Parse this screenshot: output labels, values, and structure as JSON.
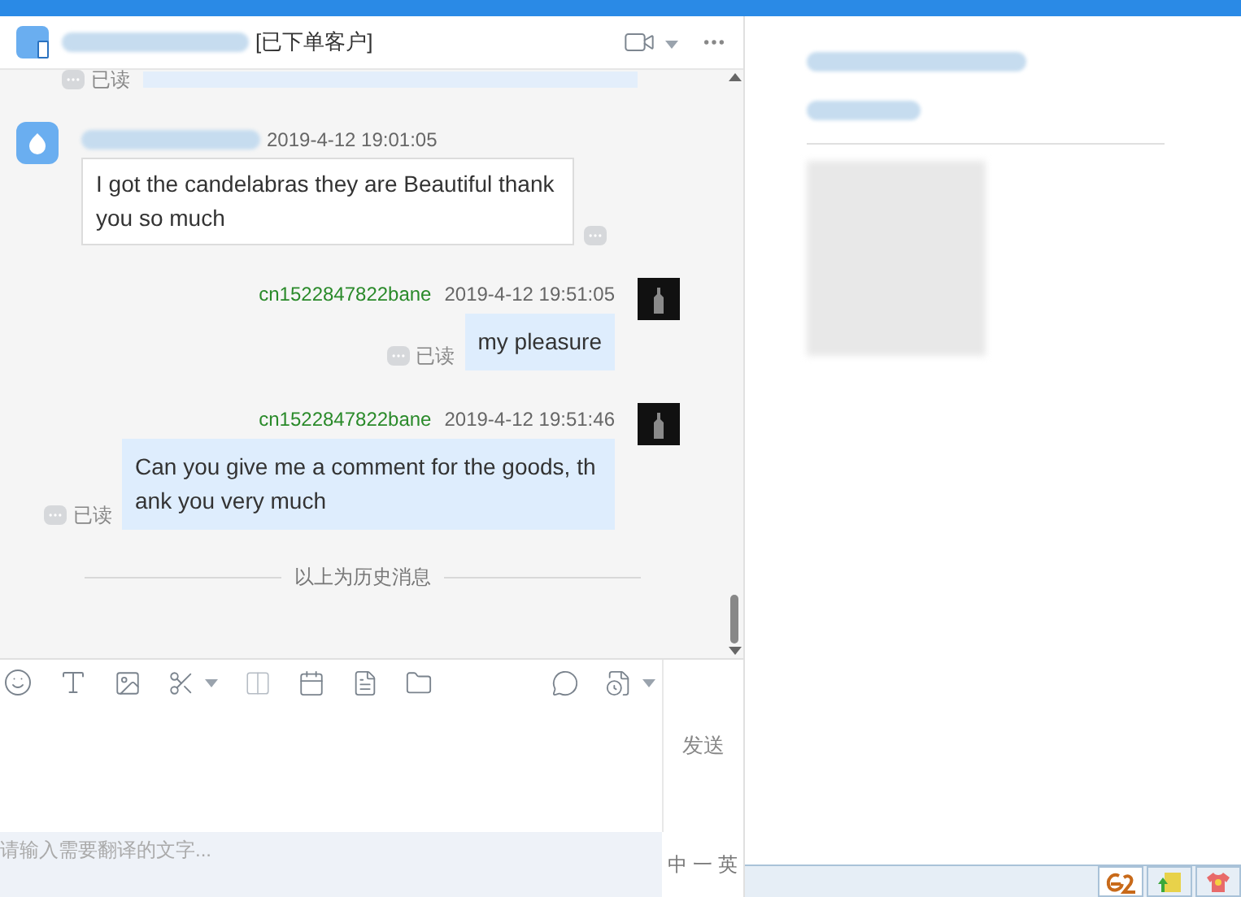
{
  "header": {
    "contact_tag": "[已下单客户]"
  },
  "messages": [
    {
      "kind": "receipt",
      "read": "已读"
    },
    {
      "kind": "received",
      "time": "2019-4-12 19:01:05",
      "text": "I got the candelabras they are Beautiful thank you so much"
    },
    {
      "kind": "sent",
      "sender": "cn1522847822bane",
      "time": "2019-4-12 19:51:05",
      "text": "my pleasure",
      "read": "已读"
    },
    {
      "kind": "sent",
      "sender": "cn1522847822bane",
      "time": "2019-4-12 19:51:46",
      "text": "Can you give me a comment for the goods, thank you very much",
      "read": "已读"
    }
  ],
  "history_divider": "以上为历史消息",
  "send_button": "发送",
  "translate": {
    "placeholder": "请输入需要翻译的文字...",
    "language_toggle": "中 一 英"
  }
}
